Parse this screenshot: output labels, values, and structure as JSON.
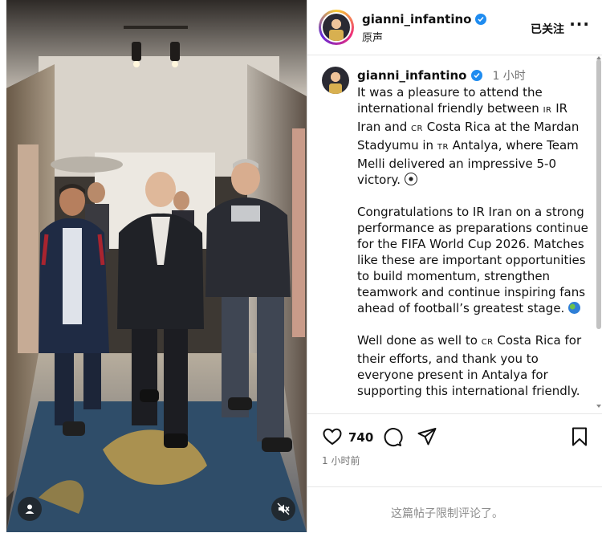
{
  "header": {
    "username": "gianni_infantino",
    "subtitle": "原声",
    "follow_label": "已关注",
    "more_label": "···"
  },
  "caption": {
    "username": "gianni_infantino",
    "time": "1 小时",
    "p1_a": "It was a pleasure to attend the international friendly between ",
    "flag_ir": "IR",
    "p1_b": " IR Iran and ",
    "flag_cr": "CR",
    "p1_c": " Costa Rica at the Mardan Stadyumu in ",
    "flag_tr": "TR",
    "p1_d": " Antalya, where Team Melli delivered an impressive 5-0 victory. ",
    "p2": "Congratulations to IR Iran on a strong performance as preparations continue for the FIFA World Cup 2026. Matches like these are important opportunities to build momentum, strengthen teamwork and continue inspiring fans ahead of football’s greatest stage. ",
    "p3_a": "Well done as well to ",
    "flag_cr2": "CR",
    "p3_b": " Costa Rica for their efforts, and thank you to everyone present in Antalya for supporting this international friendly."
  },
  "actions": {
    "like_icon": "heart-icon",
    "comment_icon": "comment-icon",
    "share_icon": "share-icon",
    "save_icon": "bookmark-icon",
    "likes_count": "740",
    "posted_time": "1 小时前"
  },
  "footer": {
    "limited_comments": "这篇帖子限制评论了。"
  },
  "media": {
    "user_tag_icon": "user-icon",
    "mute_icon": "muted-speaker-icon"
  },
  "colors": {
    "verified": "#1f8cf0",
    "muted_text": "#737373"
  }
}
